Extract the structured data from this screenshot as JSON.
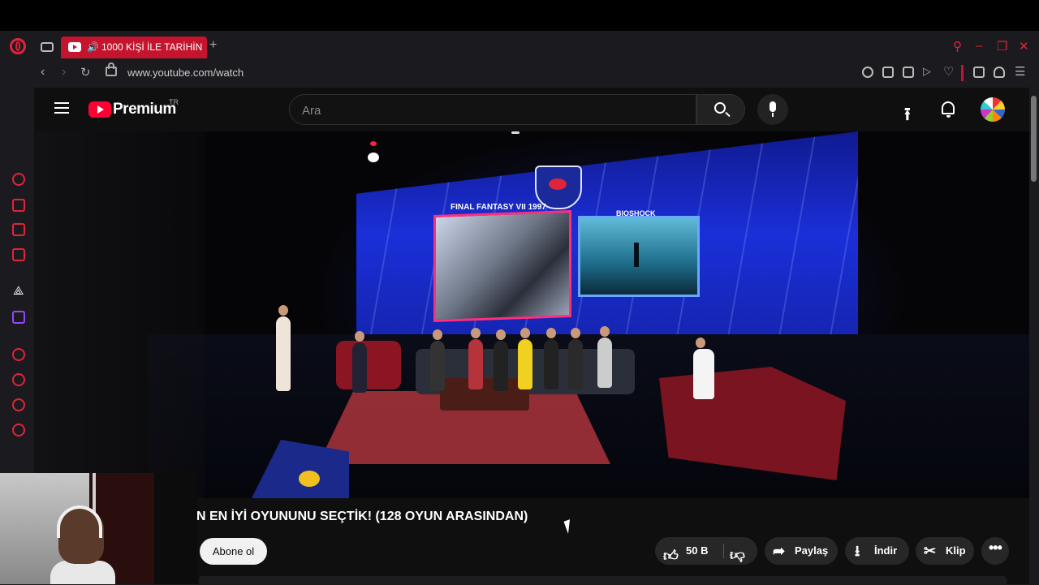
{
  "browser": {
    "tab_title": "1000 KİŞİ İLE TARİHİN",
    "new_tab": "+",
    "url": "www.youtube.com/watch"
  },
  "youtube": {
    "logo_text": "Premium",
    "country_code": "TR",
    "search": {
      "placeholder": "Ara"
    }
  },
  "video": {
    "title": "N EN İYİ OYUNUNU SEÇTİK! (128 OYUN ARASINDAN)",
    "stage_screens": {
      "left": "FINAL FANTASY VII 1997",
      "right": "BIOSHOCK"
    }
  },
  "actions": {
    "subscribe": "Abone ol",
    "like_count": "50 B",
    "share": "Paylaş",
    "download": "İndir",
    "clip": "Klip"
  },
  "colors": {
    "opera_accent": "#e0243a",
    "youtube_red": "#ff0033",
    "page_bg": "#0f0f0f"
  }
}
